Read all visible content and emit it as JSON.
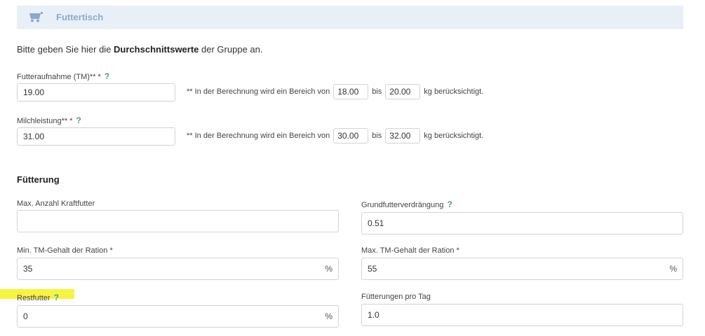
{
  "header": {
    "title": "Futtertisch",
    "icon": "feeding-cart-icon"
  },
  "intro": {
    "prefix": "Bitte geben Sie hier die ",
    "bold": "Durchschnittswerte",
    "suffix": " der Gruppe an."
  },
  "futteraufnahme": {
    "label": "Futteraufnahme (TM)** *",
    "help": "?",
    "value": "19.00",
    "note_prefix": "** In der Berechnung wird ein Bereich von",
    "range_min": "18.00",
    "note_mid": "bis",
    "range_max": "20.00",
    "note_suffix": "kg berücksichtigt."
  },
  "milchleistung": {
    "label": "Milchleistung** *",
    "help": "?",
    "value": "31.00",
    "note_prefix": "** In der Berechnung wird ein Bereich von",
    "range_min": "30.00",
    "note_mid": "bis",
    "range_max": "32.00",
    "note_suffix": "kg berücksichtigt."
  },
  "fuetterung": {
    "title": "Fütterung",
    "max_kraftfutter": {
      "label": "Max. Anzahl Kraftfutter",
      "value": ""
    },
    "grundfutter": {
      "label": "Grundfutterverdrängung",
      "help": "?",
      "value": "0.51"
    },
    "min_tm": {
      "label": "Min. TM-Gehalt der Ration *",
      "value": "35",
      "unit": "%"
    },
    "max_tm": {
      "label": "Max. TM-Gehalt der Ration *",
      "value": "55",
      "unit": "%"
    },
    "restfutter": {
      "label": "Restfutter",
      "help": "?",
      "value": "0",
      "unit": "%"
    },
    "fuetterungen": {
      "label": "Fütterungen pro Tag",
      "value": "1.0"
    }
  },
  "colors": {
    "header_bg": "#e9eff7",
    "header_text": "#8fa8c8",
    "help_icon": "#4a9a8e",
    "highlight": "#f6f32a"
  }
}
